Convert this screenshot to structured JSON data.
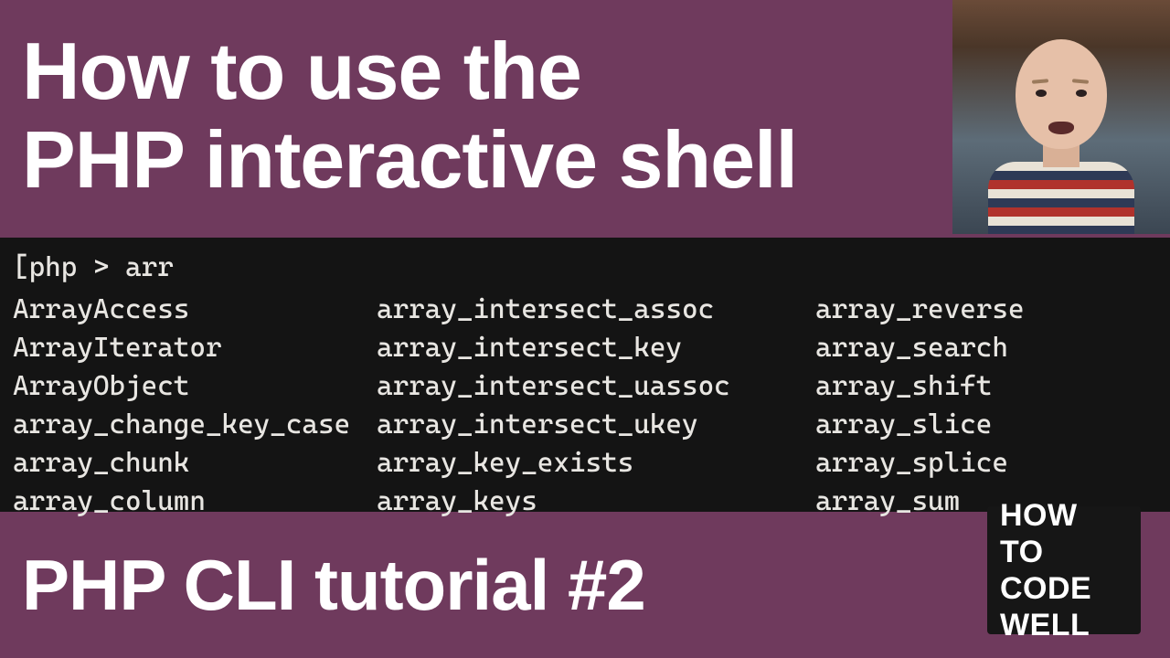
{
  "title_line1": "How to use the",
  "title_line2": "PHP interactive shell",
  "terminal": {
    "prompt": "[php > arr",
    "columns": [
      [
        "ArrayAccess",
        "ArrayIterator",
        "ArrayObject",
        "array_change_key_case",
        "array_chunk",
        "array_column"
      ],
      [
        "array_intersect_assoc",
        "array_intersect_key",
        "array_intersect_uassoc",
        "array_intersect_ukey",
        "array_key_exists",
        "array_keys"
      ],
      [
        "array_reverse",
        "array_search",
        "array_shift",
        "array_slice",
        "array_splice",
        "array_sum"
      ]
    ]
  },
  "footer": "PHP CLI tutorial #2",
  "badge": "HOW TO\nCODE\nWELL"
}
